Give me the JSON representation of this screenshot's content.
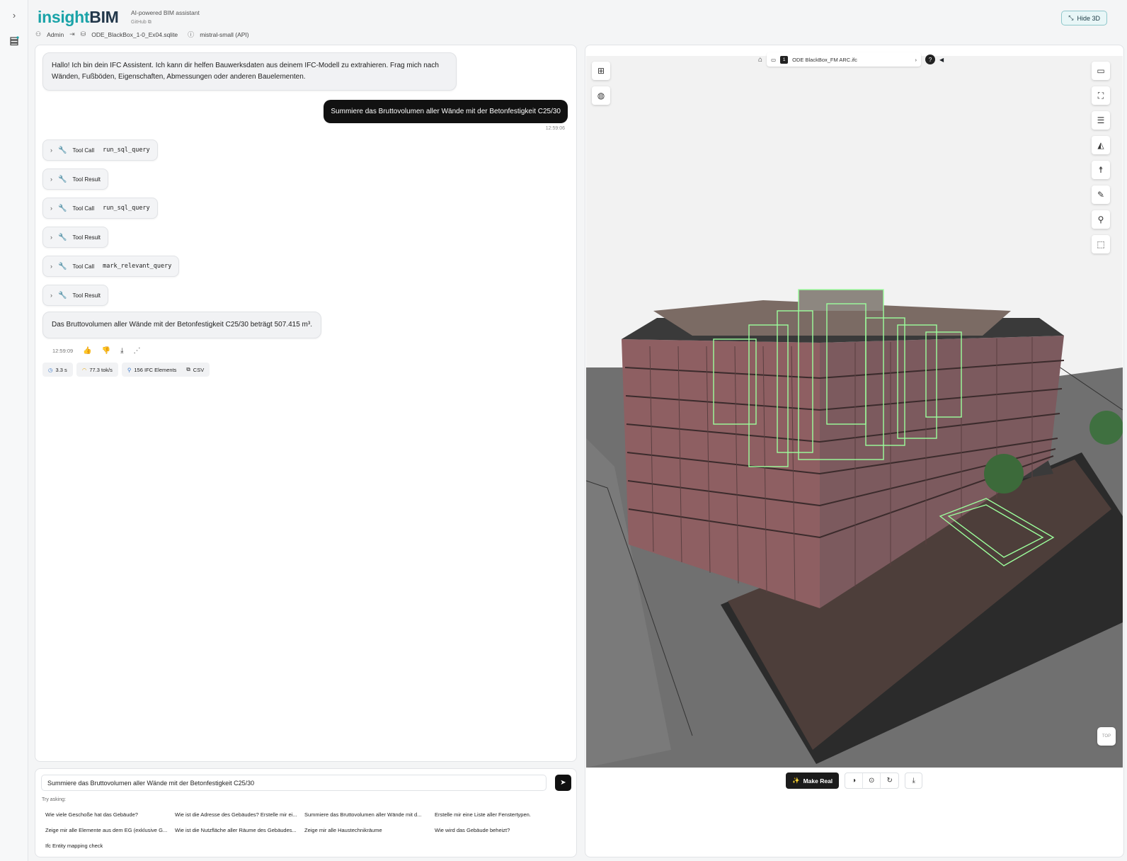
{
  "app": {
    "logo_part1": "insight",
    "logo_part2": "BIM",
    "tagline": "AI-powered BIM assistant",
    "github_label": "GitHub",
    "user": "Admin",
    "database": "ODE_BlackBox_1-0_Ex04.sqlite",
    "model": "mistral-small (API)",
    "hide3d_label": "Hide 3D"
  },
  "chat": {
    "greeting": "Hallo! Ich bin dein IFC Assistent. Ich kann dir helfen Bauwerksdaten aus deinem IFC-Modell zu extrahieren. Frag mich nach Wänden, Fußböden, Eigenschaften, Abmessungen oder anderen Bauelementen.",
    "user_message": "Summiere das Bruttovolumen aller Wände mit der Betonfestigkeit C25/30",
    "user_time": "12:59:06",
    "tool_items": [
      {
        "label": "Tool Call",
        "code": "run_sql_query"
      },
      {
        "label": "Tool Result",
        "code": ""
      },
      {
        "label": "Tool Call",
        "code": "run_sql_query"
      },
      {
        "label": "Tool Result",
        "code": ""
      },
      {
        "label": "Tool Call",
        "code": "mark_relevant_query"
      },
      {
        "label": "Tool Result",
        "code": ""
      }
    ],
    "answer": "Das Bruttovolumen aller Wände mit der Betonfestigkeit C25/30 beträgt 507.415 m³.",
    "answer_time": "12:59:09",
    "stats": {
      "time": "3.3 s",
      "speed": "77.3 tok/s",
      "elements": "156 IFC Elements",
      "csv": "CSV"
    }
  },
  "input": {
    "value": "Summiere das Bruttovolumen aller Wände mit der Betonfestigkeit C25/30",
    "try_label": "Try asking:",
    "suggestions": [
      "Wie viele Geschoße hat das Gebäude?",
      "Wie ist die Adresse des Gebäudes? Erstelle mir ei...",
      "Summiere das Bruttovolumen aller Wände mit d...",
      "Erstelle mir eine Liste aller Fenstertypen.",
      "Zeige mir alle Elemente aus dem EG (exklusive G...",
      "Wie ist die Nutzfläche aller Räume des Gebäudes...",
      "Zeige mir alle Haustechnikräume",
      "Wie wird das Gebäude beheizt?",
      "Ifc Entity mapping check"
    ]
  },
  "viewer": {
    "file_index": "1",
    "file_name": "ODE BlackBox_FM ARC.ifc",
    "help": "?",
    "make_real_label": "Make Real",
    "viewcube_label": "TOP"
  },
  "colors": {
    "accent": "#1aa3a8",
    "brand_dark": "#22374a",
    "selection_green": "#7dff9a"
  }
}
